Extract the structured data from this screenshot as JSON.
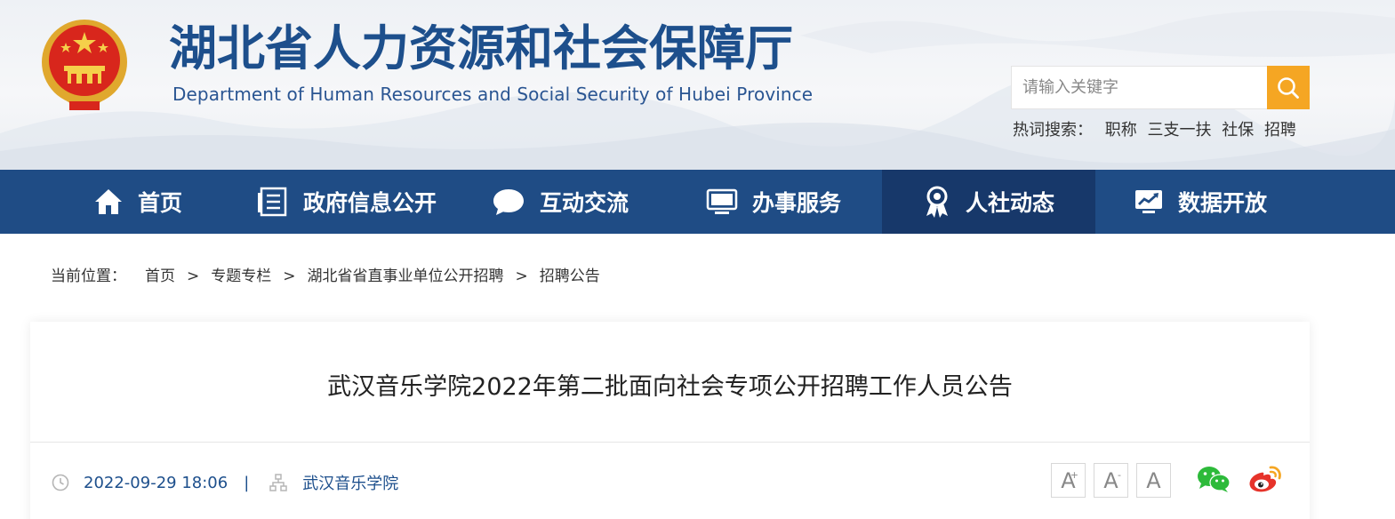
{
  "header": {
    "site_title": "湖北省人力资源和社会保障厅",
    "site_subtitle": "Department of Human Resources and Social Security of Hubei Province",
    "search_placeholder": "请输入关键字",
    "hot_label": "热词搜索：",
    "hot_words": [
      "职称",
      "三支一扶",
      "社保",
      "招聘"
    ]
  },
  "nav": {
    "items": [
      {
        "label": "首页",
        "icon": "home-icon"
      },
      {
        "label": "政府信息公开",
        "icon": "document-list-icon"
      },
      {
        "label": "互动交流",
        "icon": "chat-bubble-icon"
      },
      {
        "label": "办事服务",
        "icon": "monitor-icon"
      },
      {
        "label": "人社动态",
        "icon": "award-ribbon-icon",
        "active": true
      },
      {
        "label": "数据开放",
        "icon": "chart-screen-icon"
      }
    ]
  },
  "breadcrumb": {
    "label": "当前位置：",
    "items": [
      "首页",
      "专题专栏",
      "湖北省省直事业单位公开招聘",
      "招聘公告"
    ],
    "separator": ">"
  },
  "article": {
    "title": "武汉音乐学院2022年第二批面向社会专项公开招聘工作人员公告",
    "date": "2022-09-29 18:06",
    "divider": "|",
    "source": "武汉音乐学院",
    "font_buttons": [
      "A",
      "A",
      "A"
    ],
    "font_button_marks": [
      "+",
      "-",
      ""
    ]
  },
  "colors": {
    "nav_bg": "#1f4c85",
    "nav_active": "#17386a",
    "accent": "#f5a623",
    "title_blue": "#1d4f8c"
  }
}
